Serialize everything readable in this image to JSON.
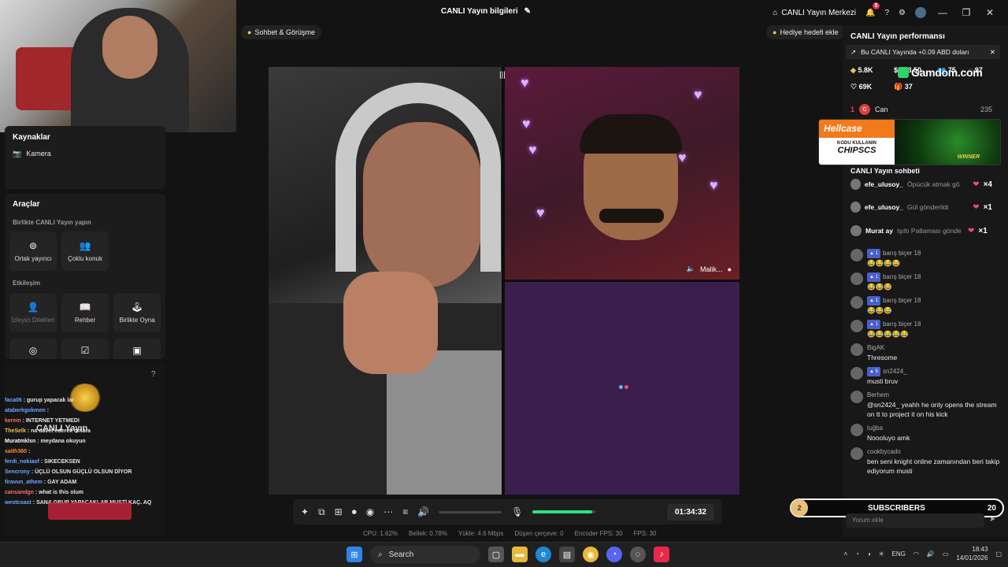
{
  "titlebar": {
    "stream_info": "CANLI Yayın bilgileri",
    "center_label": "CANLI Yayın Merkezi",
    "notif_count": "5"
  },
  "top_pills": {
    "chat": "Sohbet & Görüşme",
    "gift_goal": "Hediye hedefi ekle"
  },
  "sources": {
    "title": "Kaynaklar",
    "camera": "Kamera"
  },
  "tools": {
    "title": "Araçlar",
    "together_label": "Birlikte CANLI Yayın yapın",
    "co_host": "Ortak yayıncı",
    "multi_guest": "Çoklu konuk",
    "interaction_label": "Etkileşim",
    "viewer_requests": "İzleyici Dilekleri",
    "guide": "Rehber",
    "play_together": "Birlikte Oyna"
  },
  "overlay_chat": [
    {
      "user": "faca06",
      "text": "gurup yapacak lar"
    },
    {
      "user": "ataberkgokmen",
      "text": ""
    },
    {
      "user": "kerem",
      "text": "INTERNET YETMEDI"
    },
    {
      "user": "TheSelk",
      "text": "na davet ederek onlara"
    },
    {
      "user": "Muratmklsn",
      "text": "meydana okuyun"
    },
    {
      "user": "saith360",
      "text": ""
    },
    {
      "user": "ferdi_nokiaof",
      "text": "SIKECEKSEN"
    },
    {
      "user": "Sencrony",
      "text": "ÜÇLÜ OLSUN GÜÇLÜ OLSUN DİYOR"
    },
    {
      "user": "firavun_athem",
      "text": "GAY ADAM"
    },
    {
      "user": "cansandgn",
      "text": "what is this olum"
    },
    {
      "user": "westcoast",
      "text": "SANA GRUP YAPACAKLAR MUSTİ KAÇ. AQ"
    }
  ],
  "overlay_promo": "CANLI Yayın",
  "stream": {
    "guest_name": "Malik...",
    "timer": "01:34:32",
    "mic_level": 0.95
  },
  "stats": {
    "cpu": "CPU: 1.62%",
    "memory": "Bellek: 0.78%",
    "upload": "Yükle: 4.6 Mbps",
    "dropped": "Düşen çerçeve: 0",
    "encoder_fps": "Encoder FPS: 30",
    "fps": "FPS: 30"
  },
  "performance": {
    "title": "CANLI Yayın performansı",
    "alert": "Bu CANLI Yayında +0.09 ABD doları",
    "diamonds": "5.8K",
    "coins": "923.50",
    "views": "75",
    "viewers": "97",
    "likes": "69K",
    "gifters": "37",
    "sponsor": "Gamdom.com"
  },
  "ranking": {
    "position": "1",
    "name": "Can",
    "score": "235"
  },
  "ad": {
    "brand": "Hellcase",
    "code_label": "KODU KULLANIN",
    "code": "CHIPSCS",
    "badge": "WINNER"
  },
  "live_chat": {
    "title": "CANLI Yayın sohbeti",
    "gifts": [
      {
        "user": "efe_ulusoy_",
        "text": "Öpücük atmak gö",
        "count": "×4"
      },
      {
        "user": "efe_ulusoy_",
        "text": "Gül gönderildi",
        "count": "×1"
      },
      {
        "user": "Murat ay",
        "text": "Işıltı Patlaması gönde",
        "count": "×1"
      }
    ],
    "messages": [
      {
        "level": "1",
        "name": "barış biçer 18",
        "text": "😂😂😂😂"
      },
      {
        "level": "1",
        "name": "barış biçer 18",
        "text": "😂😂😂"
      },
      {
        "level": "1",
        "name": "barış biçer 18",
        "text": "😂😂😂"
      },
      {
        "level": "1",
        "name": "barış biçer 18",
        "text": "😂😂😂😂😂"
      },
      {
        "level": "",
        "name": "BigAK",
        "text": "Thresome"
      },
      {
        "level": "5",
        "name": "sn2424_",
        "text": "musti bruv"
      },
      {
        "level": "",
        "name": "Berhem",
        "text": "@sn2424_ yeahh he only opens the stream on tt to project it on his kick"
      },
      {
        "level": "",
        "name": "tuğba",
        "text": "Noooluyo amk"
      },
      {
        "level": "",
        "name": "cookbycado",
        "text": "ben seni knight online zamanından beri takip ediyorum musti"
      }
    ]
  },
  "subscribers": {
    "count_circle": "2",
    "label": "SUBSCRIBERS",
    "count": "20"
  },
  "comment_placeholder": "Yorum ekle",
  "taskbar": {
    "search": "Search",
    "lang": "ENG",
    "time": "18:43",
    "date": "14/01/2026"
  }
}
